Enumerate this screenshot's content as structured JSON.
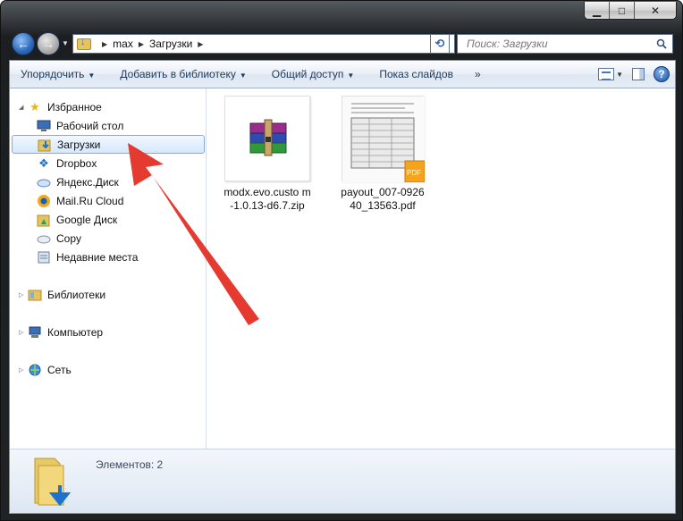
{
  "window": {
    "caption_buttons": {
      "minimize": "▁",
      "maximize": "□",
      "close": "✕"
    }
  },
  "nav": {
    "back_icon": "back-arrow-icon",
    "forward_icon": "forward-arrow-icon",
    "address": {
      "segments": [
        "max",
        "Загрузки"
      ]
    },
    "search": {
      "placeholder": "Поиск: Загрузки"
    }
  },
  "toolbar": {
    "organize": "Упорядочить",
    "add_to_library": "Добавить в библиотеку",
    "share": "Общий доступ",
    "slideshow": "Показ слайдов",
    "more": "»",
    "help": "?"
  },
  "sidebar": {
    "favorites": {
      "label": "Избранное",
      "items": [
        {
          "label": "Рабочий стол",
          "icon": "desktop-icon"
        },
        {
          "label": "Загрузки",
          "icon": "downloads-folder-icon",
          "selected": true
        },
        {
          "label": "Dropbox",
          "icon": "dropbox-icon"
        },
        {
          "label": "Яндекс.Диск",
          "icon": "yandex-disk-icon"
        },
        {
          "label": "Mail.Ru Cloud",
          "icon": "mailru-cloud-icon"
        },
        {
          "label": "Google Диск",
          "icon": "google-drive-icon"
        },
        {
          "label": "Copy",
          "icon": "copy-cloud-icon"
        },
        {
          "label": "Недавние места",
          "icon": "recent-places-icon"
        }
      ]
    },
    "libraries": {
      "label": "Библиотеки"
    },
    "computer": {
      "label": "Компьютер"
    },
    "network": {
      "label": "Сеть"
    }
  },
  "files": [
    {
      "name": "modx.evo.custom-1.0.13-d6.7.zip",
      "name_display": "modx.evo.custo m-1.0.13-d6.7.zip",
      "icon": "winrar-archive-icon"
    },
    {
      "name": "payout_007-092640_13563.pdf",
      "name_display": "payout_007-0926 40_13563.pdf",
      "icon": "pdf-document-icon"
    }
  ],
  "details": {
    "count_text": "Элементов: 2"
  },
  "colors": {
    "annotation_arrow": "#e53a2f",
    "selection": "#cde4fc"
  }
}
